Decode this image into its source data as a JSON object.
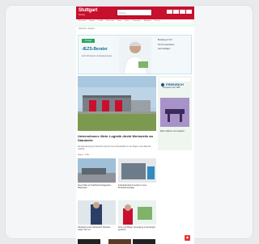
{
  "header": {
    "logo": "Stuttgart",
    "logo_sub": "Zeitung",
    "search_placeholder": "Suche",
    "brand_color": "#c8102e"
  },
  "nav": {
    "items": [
      "Startseite",
      "Region",
      "Politik",
      "Wirtschaft",
      "Sport",
      "Kultur",
      "Panorama",
      "Ratgeber",
      "Service"
    ]
  },
  "breadcrumb": "Startseite › Region",
  "promo": {
    "badge": "Anzeige",
    "headline": "-IEZS-Berater",
    "text": "Jetzt informieren und beraten lassen",
    "lines": [
      "Beratung vor Ort",
      "Termin vereinbaren",
      "Jetzt anfragen"
    ]
  },
  "hero": {
    "title": "Unternehmen: Mehr Logistik direkt Werksteile an Standorte",
    "text": "Die Erweiterung am Standort sorgt für neue Arbeitsplätze in der Region und stärkt die Logistik.",
    "meta": "Region · 3 Min."
  },
  "sidebar": {
    "brand": "FRIEDRICH",
    "sub": "Kompetenz seit 1955",
    "caption": "Mehr erfahren zum Angebot"
  },
  "articles": [
    {
      "caption": "Neue Halle am Stadtrand fertiggestellt – Bauprojekt"
    },
    {
      "caption": "Industriebetrieb investiert in neue Produktionsanlage"
    },
    {
      "caption": "Handwerk sucht Nachwuchs: Betriebe stellen sich vor"
    },
    {
      "caption": "Ärzte und Pflege: Versorgung in der Region gesichert"
    }
  ]
}
